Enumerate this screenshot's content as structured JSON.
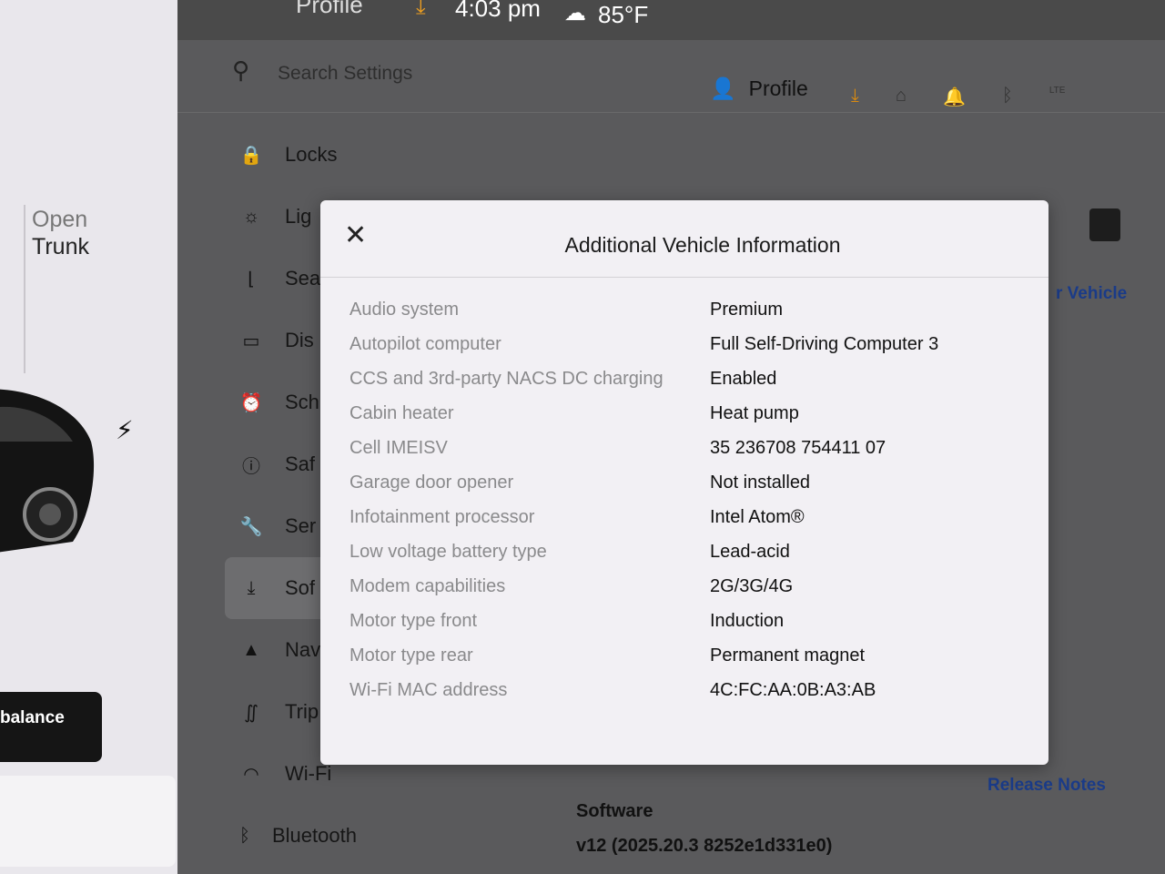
{
  "status_bar": {
    "profile": "Profile",
    "time": "4:03 pm",
    "temperature": "85°F"
  },
  "car_panel": {
    "open_label": "Open",
    "trunk_label": "Trunk",
    "balance_label": "balance"
  },
  "search": {
    "placeholder": "Search Settings"
  },
  "header": {
    "profile_label": "Profile",
    "icons": [
      "download-icon",
      "home-icon",
      "bell-icon",
      "bluetooth-icon",
      "lte-signal-icon"
    ],
    "lte_label": "LTE"
  },
  "nav": {
    "items": [
      {
        "label": "Locks",
        "icon": "lock-icon"
      },
      {
        "label": "Lig",
        "icon": "sun-icon"
      },
      {
        "label": "Sea",
        "icon": "seat-icon"
      },
      {
        "label": "Dis",
        "icon": "display-icon"
      },
      {
        "label": "Sch",
        "icon": "alarm-icon"
      },
      {
        "label": "Saf",
        "icon": "alert-icon"
      },
      {
        "label": "Ser",
        "icon": "wrench-icon"
      },
      {
        "label": "Sof",
        "icon": "download-icon"
      },
      {
        "label": "Nav",
        "icon": "navigation-icon"
      },
      {
        "label": "Trip",
        "icon": "trips-icon"
      },
      {
        "label": "Wi-Fi",
        "icon": "wifi-icon"
      },
      {
        "label": "Bluetooth",
        "icon": "bluetooth-icon"
      }
    ]
  },
  "main": {
    "vehicle_link": "r Vehicle",
    "release_notes": "Release Notes",
    "software_label": "Software",
    "software_version": "v12 (2025.20.3 8252e1d331e0)"
  },
  "modal": {
    "title": "Additional Vehicle Information",
    "rows": [
      {
        "label": "Audio system",
        "value": "Premium"
      },
      {
        "label": "Autopilot computer",
        "value": "Full Self-Driving Computer 3"
      },
      {
        "label": "CCS and 3rd-party NACS DC charging",
        "value": "Enabled"
      },
      {
        "label": "Cabin heater",
        "value": "Heat pump"
      },
      {
        "label": "Cell IMEISV",
        "value": "35 236708 754411 07"
      },
      {
        "label": "Garage door opener",
        "value": "Not installed"
      },
      {
        "label": "Infotainment processor",
        "value": "Intel Atom®"
      },
      {
        "label": "Low voltage battery type",
        "value": "Lead-acid"
      },
      {
        "label": "Modem capabilities",
        "value": "2G/3G/4G"
      },
      {
        "label": "Motor type front",
        "value": "Induction"
      },
      {
        "label": "Motor type rear",
        "value": "Permanent magnet"
      },
      {
        "label": "Wi-Fi MAC address",
        "value": "4C:FC:AA:0B:A3:AB"
      }
    ]
  },
  "colors": {
    "accent_download": "#d98a10",
    "link": "#1a3b88",
    "modal_bg": "#f2f0f4"
  }
}
